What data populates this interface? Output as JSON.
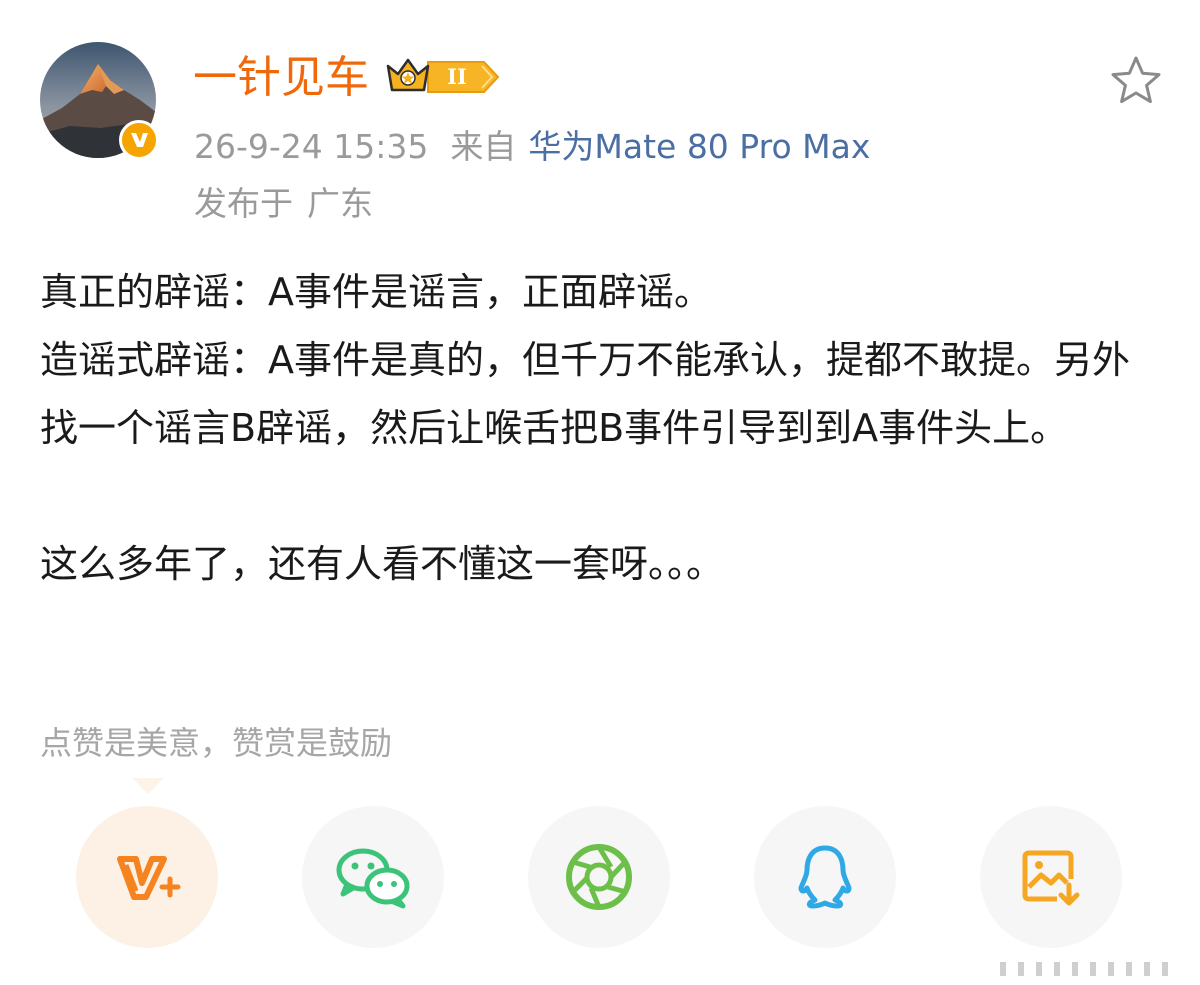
{
  "header": {
    "username": "一针见车",
    "level_badge": "II",
    "timestamp": "26-9-24 15:35",
    "from_label": "来自",
    "device": "华为Mate 80 Pro Max",
    "location_prefix": "发布于",
    "location": "广东"
  },
  "icons": {
    "avatar": "mountain-avatar",
    "verified": "verified-v-icon",
    "level": "crown-level-icon",
    "favorite": "star-icon"
  },
  "post": {
    "line1": "真正的辟谣：A事件是谣言，正面辟谣。",
    "line2": "造谣式辟谣：A事件是真的，但千万不能承认，提都不敢提。另外找一个谣言B辟谣，然后让喉舌把B事件引导到到A事件头上。",
    "line3": "这么多年了，还有人看不懂这一套呀。。。"
  },
  "reward_tip": "点赞是美意，赞赏是鼓励",
  "share_buttons": [
    {
      "icon": "v-plus-reward-icon"
    },
    {
      "icon": "wechat-icon"
    },
    {
      "icon": "moments-icon"
    },
    {
      "icon": "qq-icon"
    },
    {
      "icon": "save-image-icon"
    }
  ],
  "colors": {
    "username": "#f0680a",
    "device_link": "#4b6ea3",
    "meta_text": "#9a9a9a",
    "reward_orange": "#f5831f",
    "wechat_green": "#3cc37a",
    "moments_green": "#6cc04a",
    "qq_blue": "#2fa8e6",
    "save_orange": "#f5a623"
  }
}
